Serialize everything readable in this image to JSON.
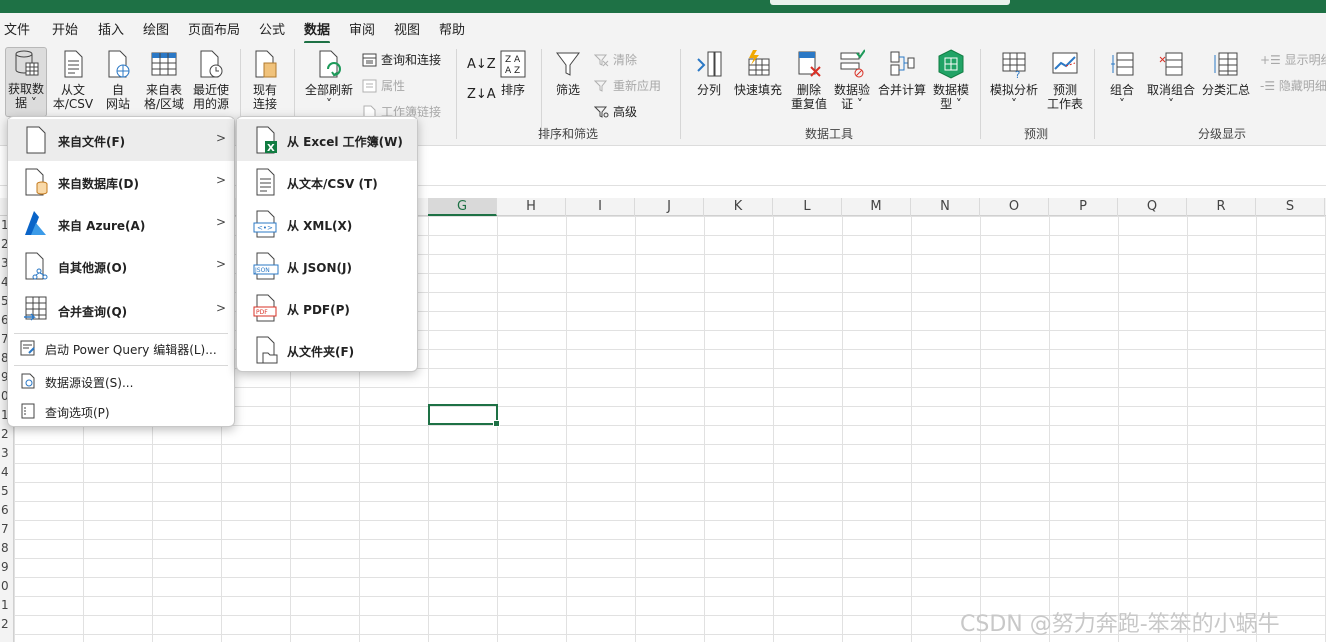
{
  "menubar": {
    "items": [
      "文件",
      "开始",
      "插入",
      "绘图",
      "页面布局",
      "公式",
      "数据",
      "审阅",
      "视图",
      "帮助"
    ],
    "active": "数据"
  },
  "ribbon": {
    "get_data": {
      "get_data_line1": "获取数",
      "get_data_line2": "据 ˅",
      "from_text_line1": "从文",
      "from_text_line2": "本/CSV",
      "from_web_line1": "自",
      "from_web_line2": "网站",
      "from_table_line1": "来自表",
      "from_table_line2": "格/区域",
      "recent_line1": "最近使",
      "recent_line2": "用的源",
      "existing_line1": "现有",
      "existing_line2": "连接"
    },
    "queries": {
      "refresh_all": "全部刷新",
      "refresh_caret": "˅",
      "queries_connections": "查询和连接",
      "properties": "属性",
      "workbook_links": "工作簿链接"
    },
    "sort_filter": {
      "sort": "排序",
      "filter": "筛选",
      "clear": "清除",
      "reapply": "重新应用",
      "advanced": "高级",
      "group_label": "排序和筛选"
    },
    "data_tools": {
      "text_to_columns": "分列",
      "flash_fill": "快速填充",
      "remove_dup_line1": "删除",
      "remove_dup_line2": "重复值",
      "validation_line1": "数据验",
      "validation_line2": "证 ˅",
      "consolidate": "合并计算",
      "data_model_line1": "数据模",
      "data_model_line2": "型 ˅",
      "group_label": "数据工具"
    },
    "forecast": {
      "what_if_line1": "模拟分析",
      "what_if_line2": "˅",
      "forecast_line1": "预测",
      "forecast_line2": "工作表",
      "group_label": "预测"
    },
    "outline": {
      "group_line1": "组合",
      "group_line2": "˅",
      "ungroup_line1": "取消组合",
      "ungroup_line2": "˅",
      "subtotal": "分类汇总",
      "show_detail": "显示明细",
      "hide_detail": "隐藏明细",
      "group_label": "分级显示"
    }
  },
  "columns": [
    "G",
    "H",
    "I",
    "J",
    "K",
    "L",
    "M",
    "N",
    "O",
    "P",
    "Q",
    "R",
    "S"
  ],
  "selected_column": "G",
  "row_numbers": [
    "1",
    "2",
    "3",
    "4",
    "5",
    "6",
    "7",
    "8",
    "9",
    "0",
    "1",
    "2",
    "3",
    "4",
    "5",
    "6",
    "7",
    "8",
    "9",
    "0",
    "1",
    "2"
  ],
  "menu_get_data": {
    "items": [
      {
        "label": "来自文件(F)",
        "icon": "file-icon"
      },
      {
        "label": "来自数据库(D)",
        "icon": "database-file-icon"
      },
      {
        "label": "来自 Azure(A)",
        "icon": "azure-icon"
      },
      {
        "label": "自其他源(O)",
        "icon": "other-sources-icon"
      },
      {
        "label": "合并查询(Q)",
        "icon": "combine-queries-icon"
      }
    ],
    "launch_pq": "启动 Power Query 编辑器(L)...",
    "data_source_settings": "数据源设置(S)...",
    "query_options": "查询选项(P)"
  },
  "menu_from_file": {
    "items": [
      {
        "label": "从 Excel 工作簿(W)",
        "icon": "excel-workbook-icon"
      },
      {
        "label": "从文本/CSV (T)",
        "icon": "text-csv-icon"
      },
      {
        "label": "从 XML(X)",
        "icon": "xml-icon"
      },
      {
        "label": "从 JSON(J)",
        "icon": "json-icon"
      },
      {
        "label": "从 PDF(P)",
        "icon": "pdf-icon"
      },
      {
        "label": "从文件夹(F)",
        "icon": "folder-icon"
      }
    ]
  },
  "watermark": "CSDN @努力奔跑-笨笨的小蜗牛",
  "colors": {
    "accent": "#1e7145"
  }
}
